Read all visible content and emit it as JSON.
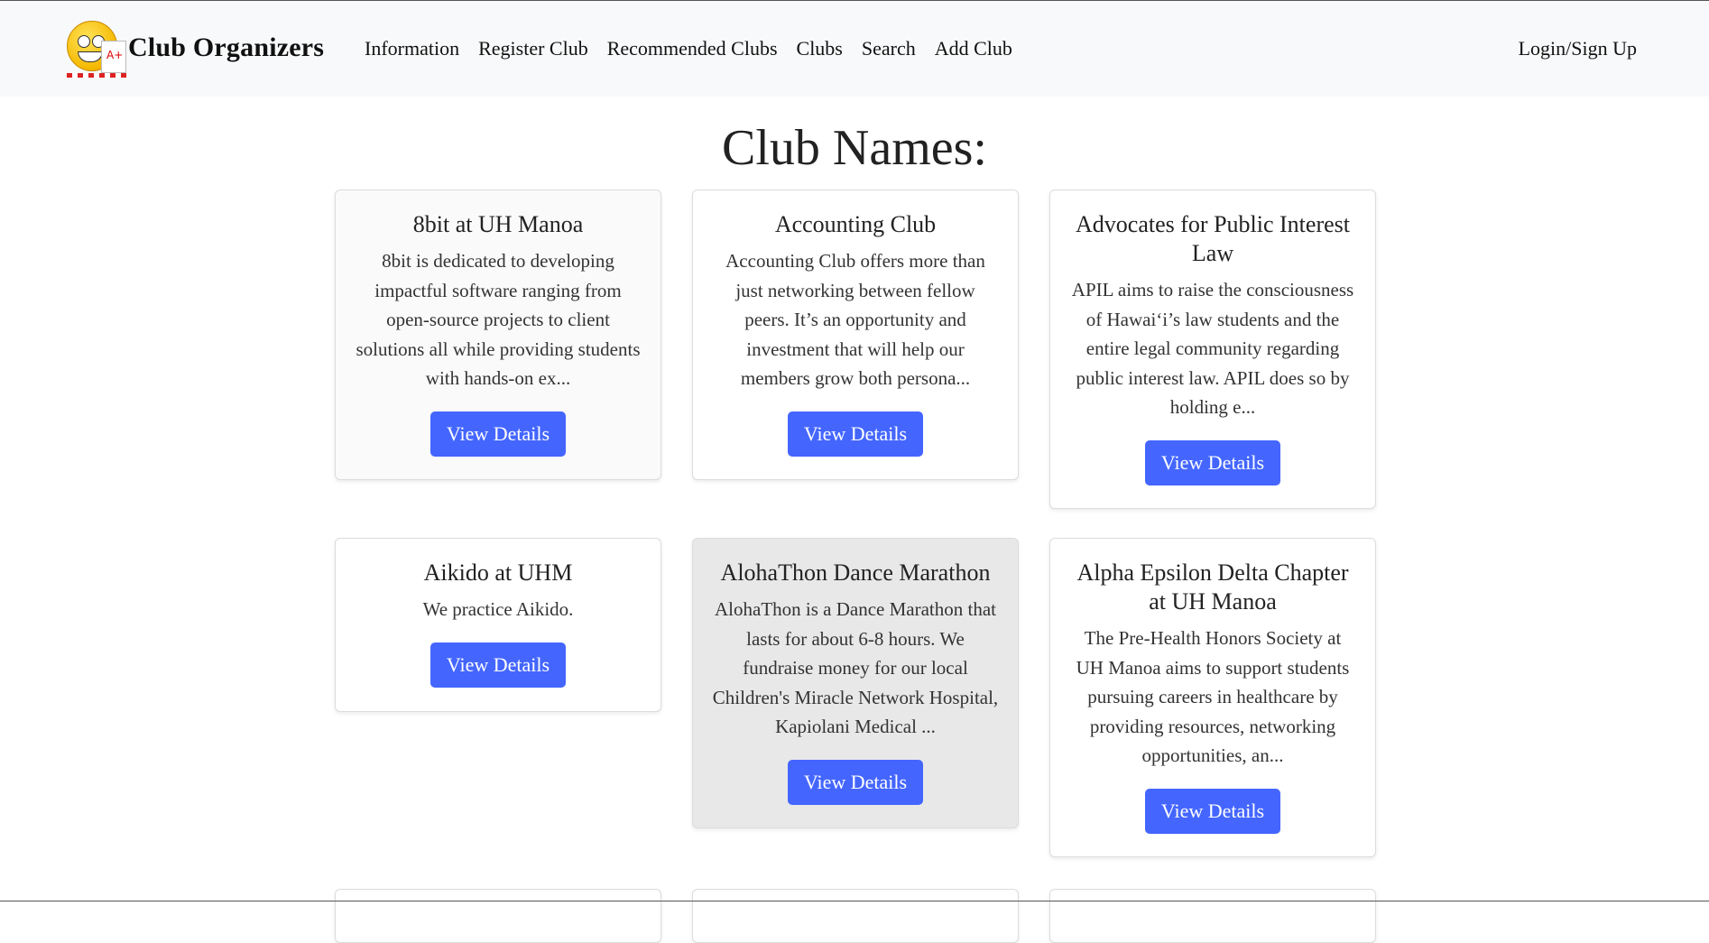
{
  "navbar": {
    "brand": "Club Organizers",
    "logo_icon": "smiley-grade-logo-icon",
    "links": [
      "Information",
      "Register Club",
      "Recommended Clubs",
      "Clubs",
      "Search",
      "Add Club"
    ],
    "login": "Login/Sign Up"
  },
  "main": {
    "title": "Club Names:",
    "button_label": "View Details",
    "cards": [
      {
        "name": "8bit at UH Manoa",
        "description": "8bit is dedicated to developing impactful software ranging from open-source projects to client solutions all while providing students with hands-on ex..."
      },
      {
        "name": "Accounting Club",
        "description": "Accounting Club offers more than just networking between fellow peers. It’s an opportunity and investment that will help our members grow both persona..."
      },
      {
        "name": "Advocates for Public Interest Law",
        "description": "APIL aims to raise the consciousness of Hawai‘i’s law students and the entire legal community regarding public interest law. APIL does so by holding e..."
      },
      {
        "name": "Aikido at UHM",
        "description": "We practice Aikido."
      },
      {
        "name": "AlohaThon Dance Marathon",
        "description": "AlohaThon is a Dance Marathon that lasts for about 6-8 hours. We fundraise money for our local Children's Miracle Network Hospital, Kapiolani Medical ..."
      },
      {
        "name": "Alpha Epsilon Delta Chapter at UH Manoa",
        "description": "The Pre-Health Honors Society at UH Manoa aims to support students pursuing careers in healthcare by providing resources, networking opportunities, an..."
      }
    ]
  },
  "colors": {
    "navbar_bg": "#f8f9fa",
    "button_bg": "#4466ff",
    "hovered_card_bg": "#e8e8e8"
  }
}
